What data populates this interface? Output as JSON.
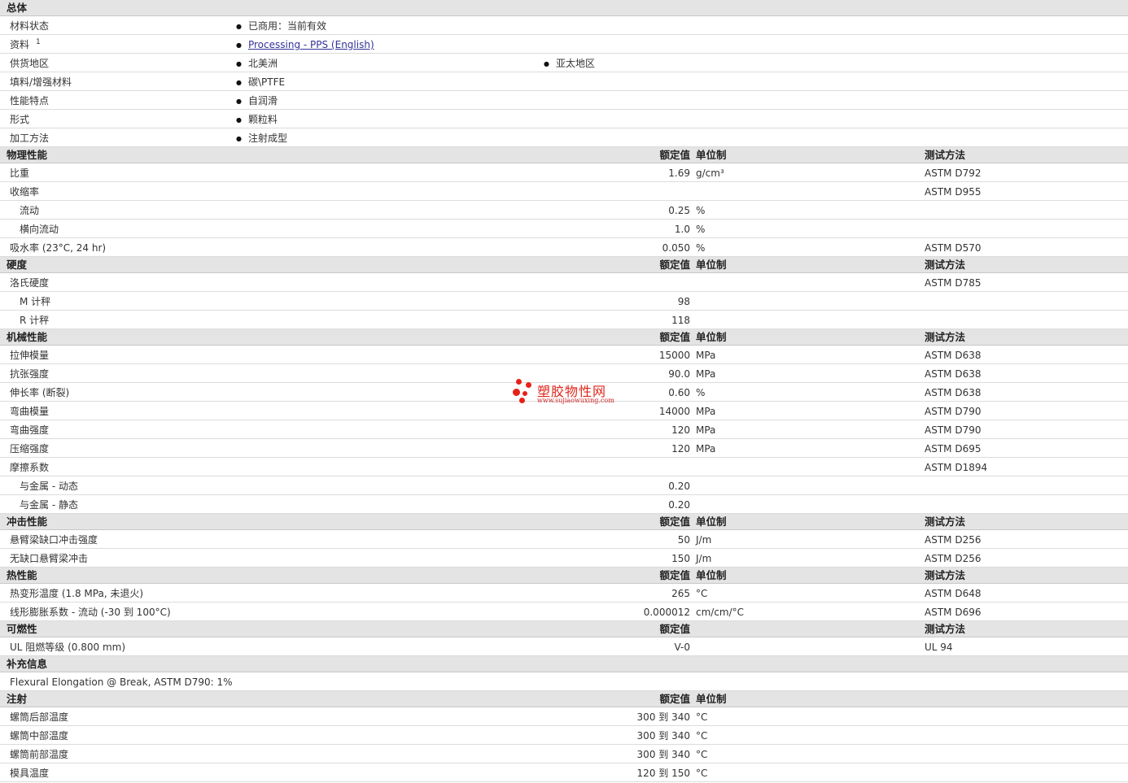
{
  "column_headers": {
    "value": "额定值",
    "unit": "单位制",
    "test": "测试方法"
  },
  "general": {
    "title": "总体",
    "rows": [
      {
        "label": "材料状态",
        "items": [
          "已商用：当前有效"
        ]
      },
      {
        "label": "资料",
        "sup": "1",
        "items": [
          "Processing - PPS (English)"
        ],
        "link": true
      },
      {
        "label": "供货地区",
        "items": [
          "北美洲",
          "亚太地区"
        ]
      },
      {
        "label": "填料/增强材料",
        "items": [
          "碳\\PTFE"
        ]
      },
      {
        "label": "性能特点",
        "items": [
          "自润滑"
        ]
      },
      {
        "label": "形式",
        "items": [
          "颗粒料"
        ]
      },
      {
        "label": "加工方法",
        "items": [
          "注射成型"
        ]
      }
    ]
  },
  "physical": {
    "title": "物理性能",
    "rows": [
      {
        "label": "比重",
        "value": "1.69",
        "unit": "g/cm³",
        "test": "ASTM D792"
      },
      {
        "label": "收缩率",
        "value": "",
        "unit": "",
        "test": "ASTM D955"
      },
      {
        "label": "流动",
        "value": "0.25",
        "unit": "%",
        "test": "",
        "sub": true
      },
      {
        "label": "横向流动",
        "value": "1.0",
        "unit": "%",
        "test": "",
        "sub": true
      },
      {
        "label": "吸水率 (23°C, 24 hr)",
        "value": "0.050",
        "unit": "%",
        "test": "ASTM D570"
      }
    ]
  },
  "hardness": {
    "title": "硬度",
    "rows": [
      {
        "label": "洛氏硬度",
        "value": "",
        "unit": "",
        "test": "ASTM D785"
      },
      {
        "label": "M 计秤",
        "value": "98",
        "unit": "",
        "test": "",
        "sub": true
      },
      {
        "label": "R 计秤",
        "value": "118",
        "unit": "",
        "test": "",
        "sub": true
      }
    ]
  },
  "mechanical": {
    "title": "机械性能",
    "rows": [
      {
        "label": "拉伸模量",
        "value": "15000",
        "unit": "MPa",
        "test": "ASTM D638"
      },
      {
        "label": "抗张强度",
        "value": "90.0",
        "unit": "MPa",
        "test": "ASTM D638"
      },
      {
        "label": "伸长率 (断裂)",
        "value": "0.60",
        "unit": "%",
        "test": "ASTM D638"
      },
      {
        "label": "弯曲模量",
        "value": "14000",
        "unit": "MPa",
        "test": "ASTM D790"
      },
      {
        "label": "弯曲强度",
        "value": "120",
        "unit": "MPa",
        "test": "ASTM D790"
      },
      {
        "label": "压缩强度",
        "value": "120",
        "unit": "MPa",
        "test": "ASTM D695"
      },
      {
        "label": "摩擦系数",
        "value": "",
        "unit": "",
        "test": "ASTM D1894"
      },
      {
        "label": "与金属 - 动态",
        "value": "0.20",
        "unit": "",
        "test": "",
        "sub": true
      },
      {
        "label": "与金属 - 静态",
        "value": "0.20",
        "unit": "",
        "test": "",
        "sub": true
      }
    ]
  },
  "impact": {
    "title": "冲击性能",
    "rows": [
      {
        "label": "悬臂梁缺口冲击强度",
        "value": "50",
        "unit": "J/m",
        "test": "ASTM D256"
      },
      {
        "label": "无缺口悬臂梁冲击",
        "value": "150",
        "unit": "J/m",
        "test": "ASTM D256"
      }
    ]
  },
  "thermal": {
    "title": "热性能",
    "rows": [
      {
        "label": "热变形温度 (1.8 MPa, 未退火)",
        "value": "265",
        "unit": "°C",
        "test": "ASTM D648"
      },
      {
        "label": "线形膨胀系数 - 流动 (-30 到 100°C)",
        "value": "0.000012",
        "unit": "cm/cm/°C",
        "test": "ASTM D696"
      }
    ]
  },
  "flammability": {
    "title": "可燃性",
    "rows": [
      {
        "label": "UL 阻燃等级 (0.800 mm)",
        "value": "V-0",
        "unit": "",
        "test": "UL 94"
      }
    ]
  },
  "supplementary": {
    "title": "补充信息",
    "note": "Flexural Elongation @ Break, ASTM D790: 1%"
  },
  "injection": {
    "title": "注射",
    "rows": [
      {
        "label": "螺筒后部温度",
        "value": "300 到 340",
        "unit": "°C"
      },
      {
        "label": "螺筒中部温度",
        "value": "300 到 340",
        "unit": "°C"
      },
      {
        "label": "螺筒前部温度",
        "value": "300 到 340",
        "unit": "°C"
      },
      {
        "label": "模具温度",
        "value": "120 到 150",
        "unit": "°C"
      }
    ]
  },
  "watermark": {
    "name": "塑胶物性网",
    "url": "www.sujiaowuxing.com",
    "color": "#e8201a"
  }
}
